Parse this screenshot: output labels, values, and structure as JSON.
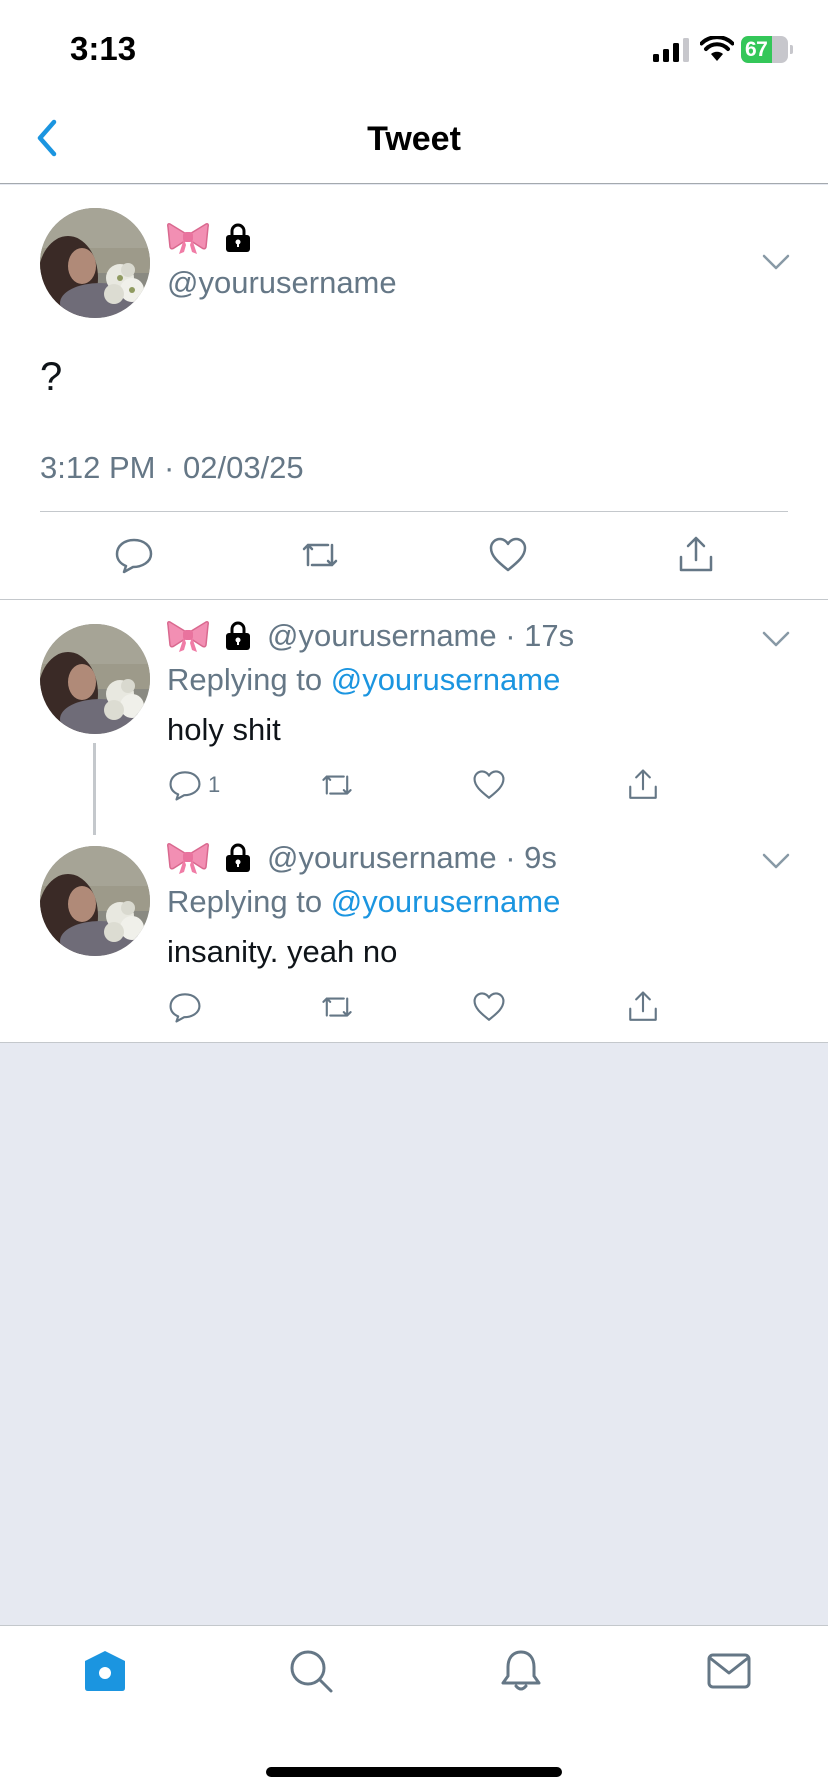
{
  "status_bar": {
    "time": "3:13",
    "battery": {
      "percent": 67,
      "label": "67",
      "color": "#34c759"
    }
  },
  "nav": {
    "title": "Tweet",
    "back_icon": "chevron-left-icon"
  },
  "colors": {
    "accent": "#1b95e0",
    "secondary_text": "#657786",
    "divider": "#c4c8cc",
    "background": "#e6e9f1"
  },
  "main_tweet": {
    "handle": "@yourusername",
    "name_emojis": [
      "bow-icon",
      "lock-icon"
    ],
    "body": "?",
    "timestamp": "3:12 PM · 02/03/25",
    "actions": [
      "reply-icon",
      "retweet-icon",
      "like-icon",
      "share-icon"
    ]
  },
  "replies": [
    {
      "handle_time": "@yourusername · 17s",
      "replying_prefix": "Replying to",
      "replying_to": "@yourusername",
      "text": "holy shit",
      "reply_count": "1"
    },
    {
      "handle_time": "@yourusername · 9s",
      "replying_prefix": "Replying to",
      "replying_to": "@yourusername",
      "text": "insanity. yeah no",
      "reply_count": ""
    }
  ],
  "tab_bar": {
    "tabs": [
      "home-icon",
      "search-icon",
      "notifications-icon",
      "messages-icon"
    ],
    "active": "home-icon"
  }
}
